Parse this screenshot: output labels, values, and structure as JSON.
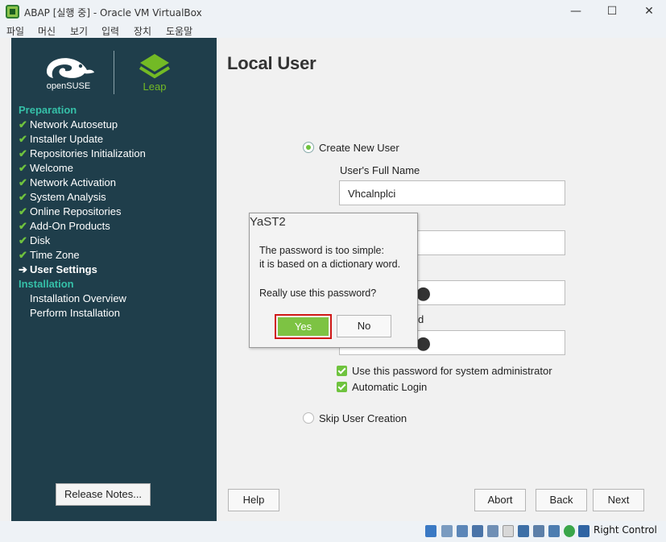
{
  "window": {
    "title": "ABAP [실행 중] - Oracle VM VirtualBox",
    "menu": [
      "파일",
      "머신",
      "보기",
      "입력",
      "장치",
      "도움말"
    ],
    "controls": {
      "minimize": "—",
      "maximize": "☐",
      "close": "✕"
    }
  },
  "sidebar": {
    "logo_text": "openSUSE",
    "leap_text": "Leap",
    "sections": [
      {
        "title": "Preparation",
        "steps": [
          {
            "label": "Network Autosetup",
            "state": "done"
          },
          {
            "label": "Installer Update",
            "state": "done"
          },
          {
            "label": "Repositories Initialization",
            "state": "done"
          },
          {
            "label": "Welcome",
            "state": "done"
          },
          {
            "label": "Network Activation",
            "state": "done"
          },
          {
            "label": "System Analysis",
            "state": "done"
          },
          {
            "label": "Online Repositories",
            "state": "done"
          },
          {
            "label": "Add-On Products",
            "state": "done"
          },
          {
            "label": "Disk",
            "state": "done"
          },
          {
            "label": "Time Zone",
            "state": "done"
          },
          {
            "label": "User Settings",
            "state": "current"
          }
        ]
      },
      {
        "title": "Installation",
        "steps": [
          {
            "label": "Installation Overview",
            "state": "pending"
          },
          {
            "label": "Perform Installation",
            "state": "pending"
          }
        ]
      }
    ],
    "release_notes_label": "Release Notes..."
  },
  "main": {
    "title": "Local User",
    "create_new_user_label": "Create New User",
    "full_name_label": "User's Full Name",
    "full_name_value": "Vhcalnplci",
    "password_dots": "●",
    "confirm_label_fragment": "d",
    "use_password_for_admin_label": "Use this password for system administrator",
    "automatic_login_label": "Automatic Login",
    "skip_user_creation_label": "Skip User Creation",
    "buttons": {
      "help": "Help",
      "abort": "Abort",
      "back": "Back",
      "next": "Next"
    }
  },
  "dialog": {
    "title": "YaST2",
    "message_line1": "The password is too simple:",
    "message_line2": "it is based on a dictionary word.",
    "question": "Really use this password?",
    "yes_label": "Yes",
    "no_label": "No"
  },
  "statusbar": {
    "host_key_label": "Right Control"
  },
  "colors": {
    "sidebar_bg": "#1f3e4b",
    "section_accent": "#35c0a8",
    "check_green": "#6fc33e",
    "yes_button": "#7dc343",
    "highlight_border": "#d01717"
  }
}
